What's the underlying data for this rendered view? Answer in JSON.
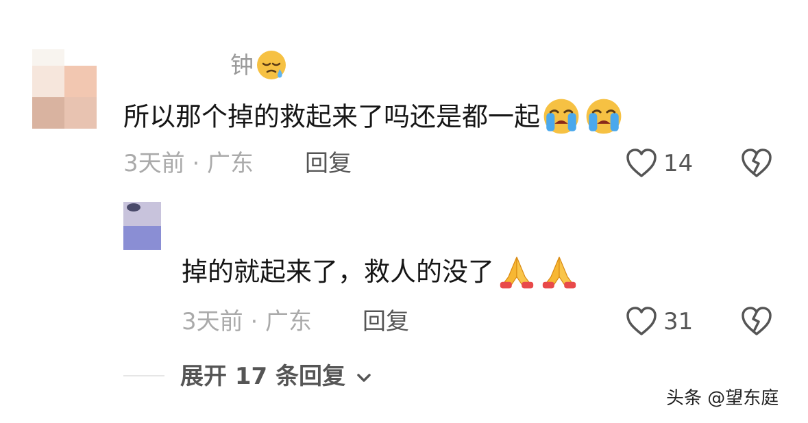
{
  "comments": [
    {
      "username": "钟",
      "text": "所以那个掉的救起来了吗还是都一起",
      "time_location": "3天前 · 广东",
      "reply_label": "回复",
      "likes": "14"
    },
    {
      "username": "",
      "text": "掉的就起来了，救人的没了",
      "time_location": "3天前 · 广东",
      "reply_label": "回复",
      "likes": "31"
    }
  ],
  "expand_label": "展开 17 条回复",
  "watermark": "头条 @望东庭",
  "icons": {
    "like": "heart-outline-icon",
    "dislike": "broken-heart-icon",
    "expand": "chevron-down-icon",
    "emoji_sleepy": "sleepy-face-icon",
    "emoji_crying": "loudly-crying-face-icon",
    "emoji_pray": "folded-hands-icon"
  },
  "colors": {
    "text_primary": "#161616",
    "text_secondary": "#aaaaaa",
    "action": "#555555"
  }
}
